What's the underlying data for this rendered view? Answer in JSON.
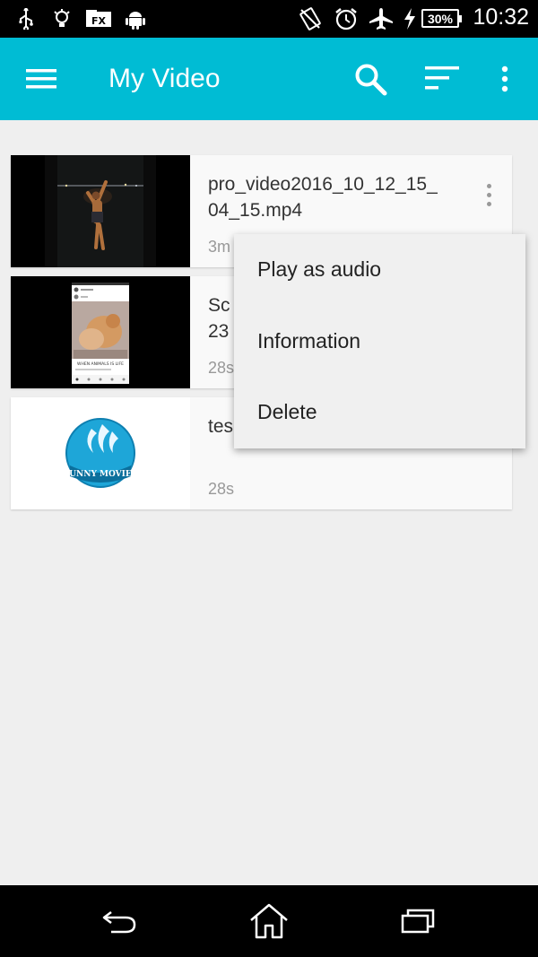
{
  "status_bar": {
    "time": "10:32",
    "battery": "30%",
    "icons": [
      "usb-icon",
      "bulb-icon",
      "fx-icon",
      "android-icon",
      "no-sim-icon",
      "alarm-icon",
      "airplane-icon",
      "charging-icon"
    ],
    "fx_label": "FX"
  },
  "app_bar": {
    "title": "My Video",
    "color": "#00bcd4",
    "icons": [
      "menu-icon",
      "search-icon",
      "sort-icon",
      "more-vert-icon"
    ]
  },
  "videos": [
    {
      "title": "pro_video2016_10_12_15_\n04_15.mp4",
      "duration": "3m"
    },
    {
      "title": "Sc\n23",
      "duration": "28s"
    },
    {
      "title": "tes",
      "duration": "28s",
      "thumb_text": "FUNNY MOVIES"
    }
  ],
  "thumb2_text": "WHEN ANIMALS IS LIFE",
  "context_menu": {
    "items": [
      "Play as audio",
      "Information",
      "Delete"
    ]
  },
  "nav_bar": {
    "icons": [
      "back-icon",
      "home-icon",
      "recents-icon"
    ]
  }
}
